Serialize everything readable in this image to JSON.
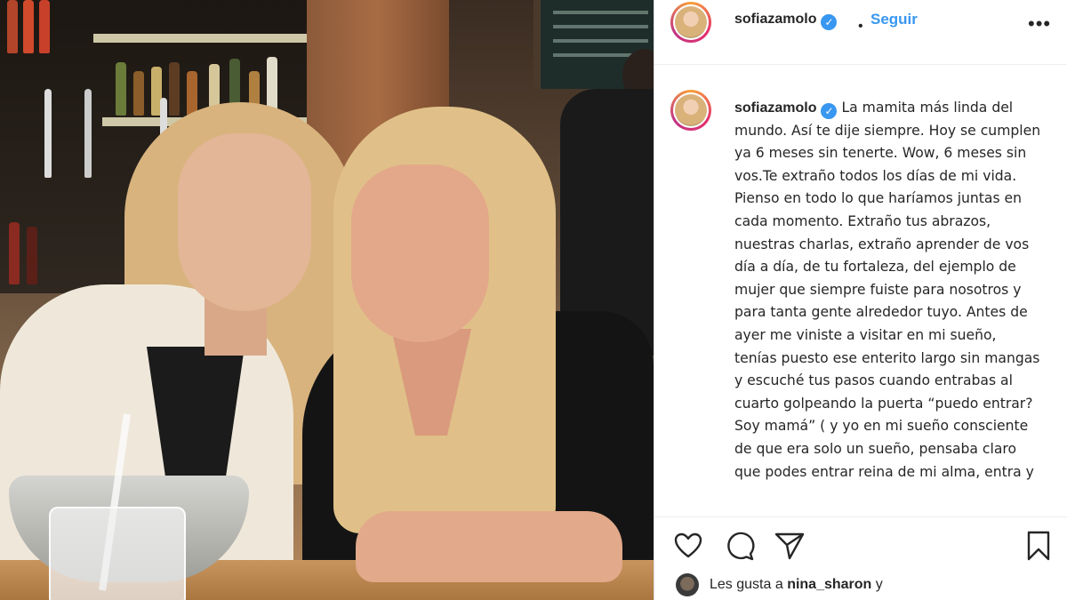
{
  "post": {
    "username": "sofiazamolo",
    "separator": "•",
    "follow_label": "Seguir",
    "more_label": "•••",
    "caption_text": "La mamita más linda del mundo. Así te dije siempre. Hoy se cumplen ya 6 meses sin tenerte. Wow, 6 meses sin vos.Te extraño todos los días de mi vida. Pienso en todo lo que haríamos juntas en cada momento. Extraño tus abrazos, nuestras charlas, extraño aprender de vos día a día, de tu fortaleza, del ejemplo de mujer que siempre fuiste para nosotros y para tanta gente alrededor tuyo. Antes de ayer me viniste a visitar en mi sueño, tenías puesto ese enterito largo sin mangas y escuché tus pasos cuando entrabas al cuarto golpeando la puerta “puedo entrar? Soy mamá” ( y yo en mi sueño consciente de que era solo un sueño, pensaba claro que podes entrar reina de mi alma, entra y"
  },
  "likes": {
    "prefix": "Les gusta a",
    "user": "nina_sharon",
    "suffix": "y"
  },
  "icons": {
    "verified": "verified-badge-icon",
    "like": "heart-icon",
    "comment": "comment-icon",
    "share": "paper-plane-icon",
    "save": "bookmark-icon"
  },
  "colors": {
    "accent_blue": "#3897f0",
    "text": "#262626",
    "border": "#efefef"
  }
}
